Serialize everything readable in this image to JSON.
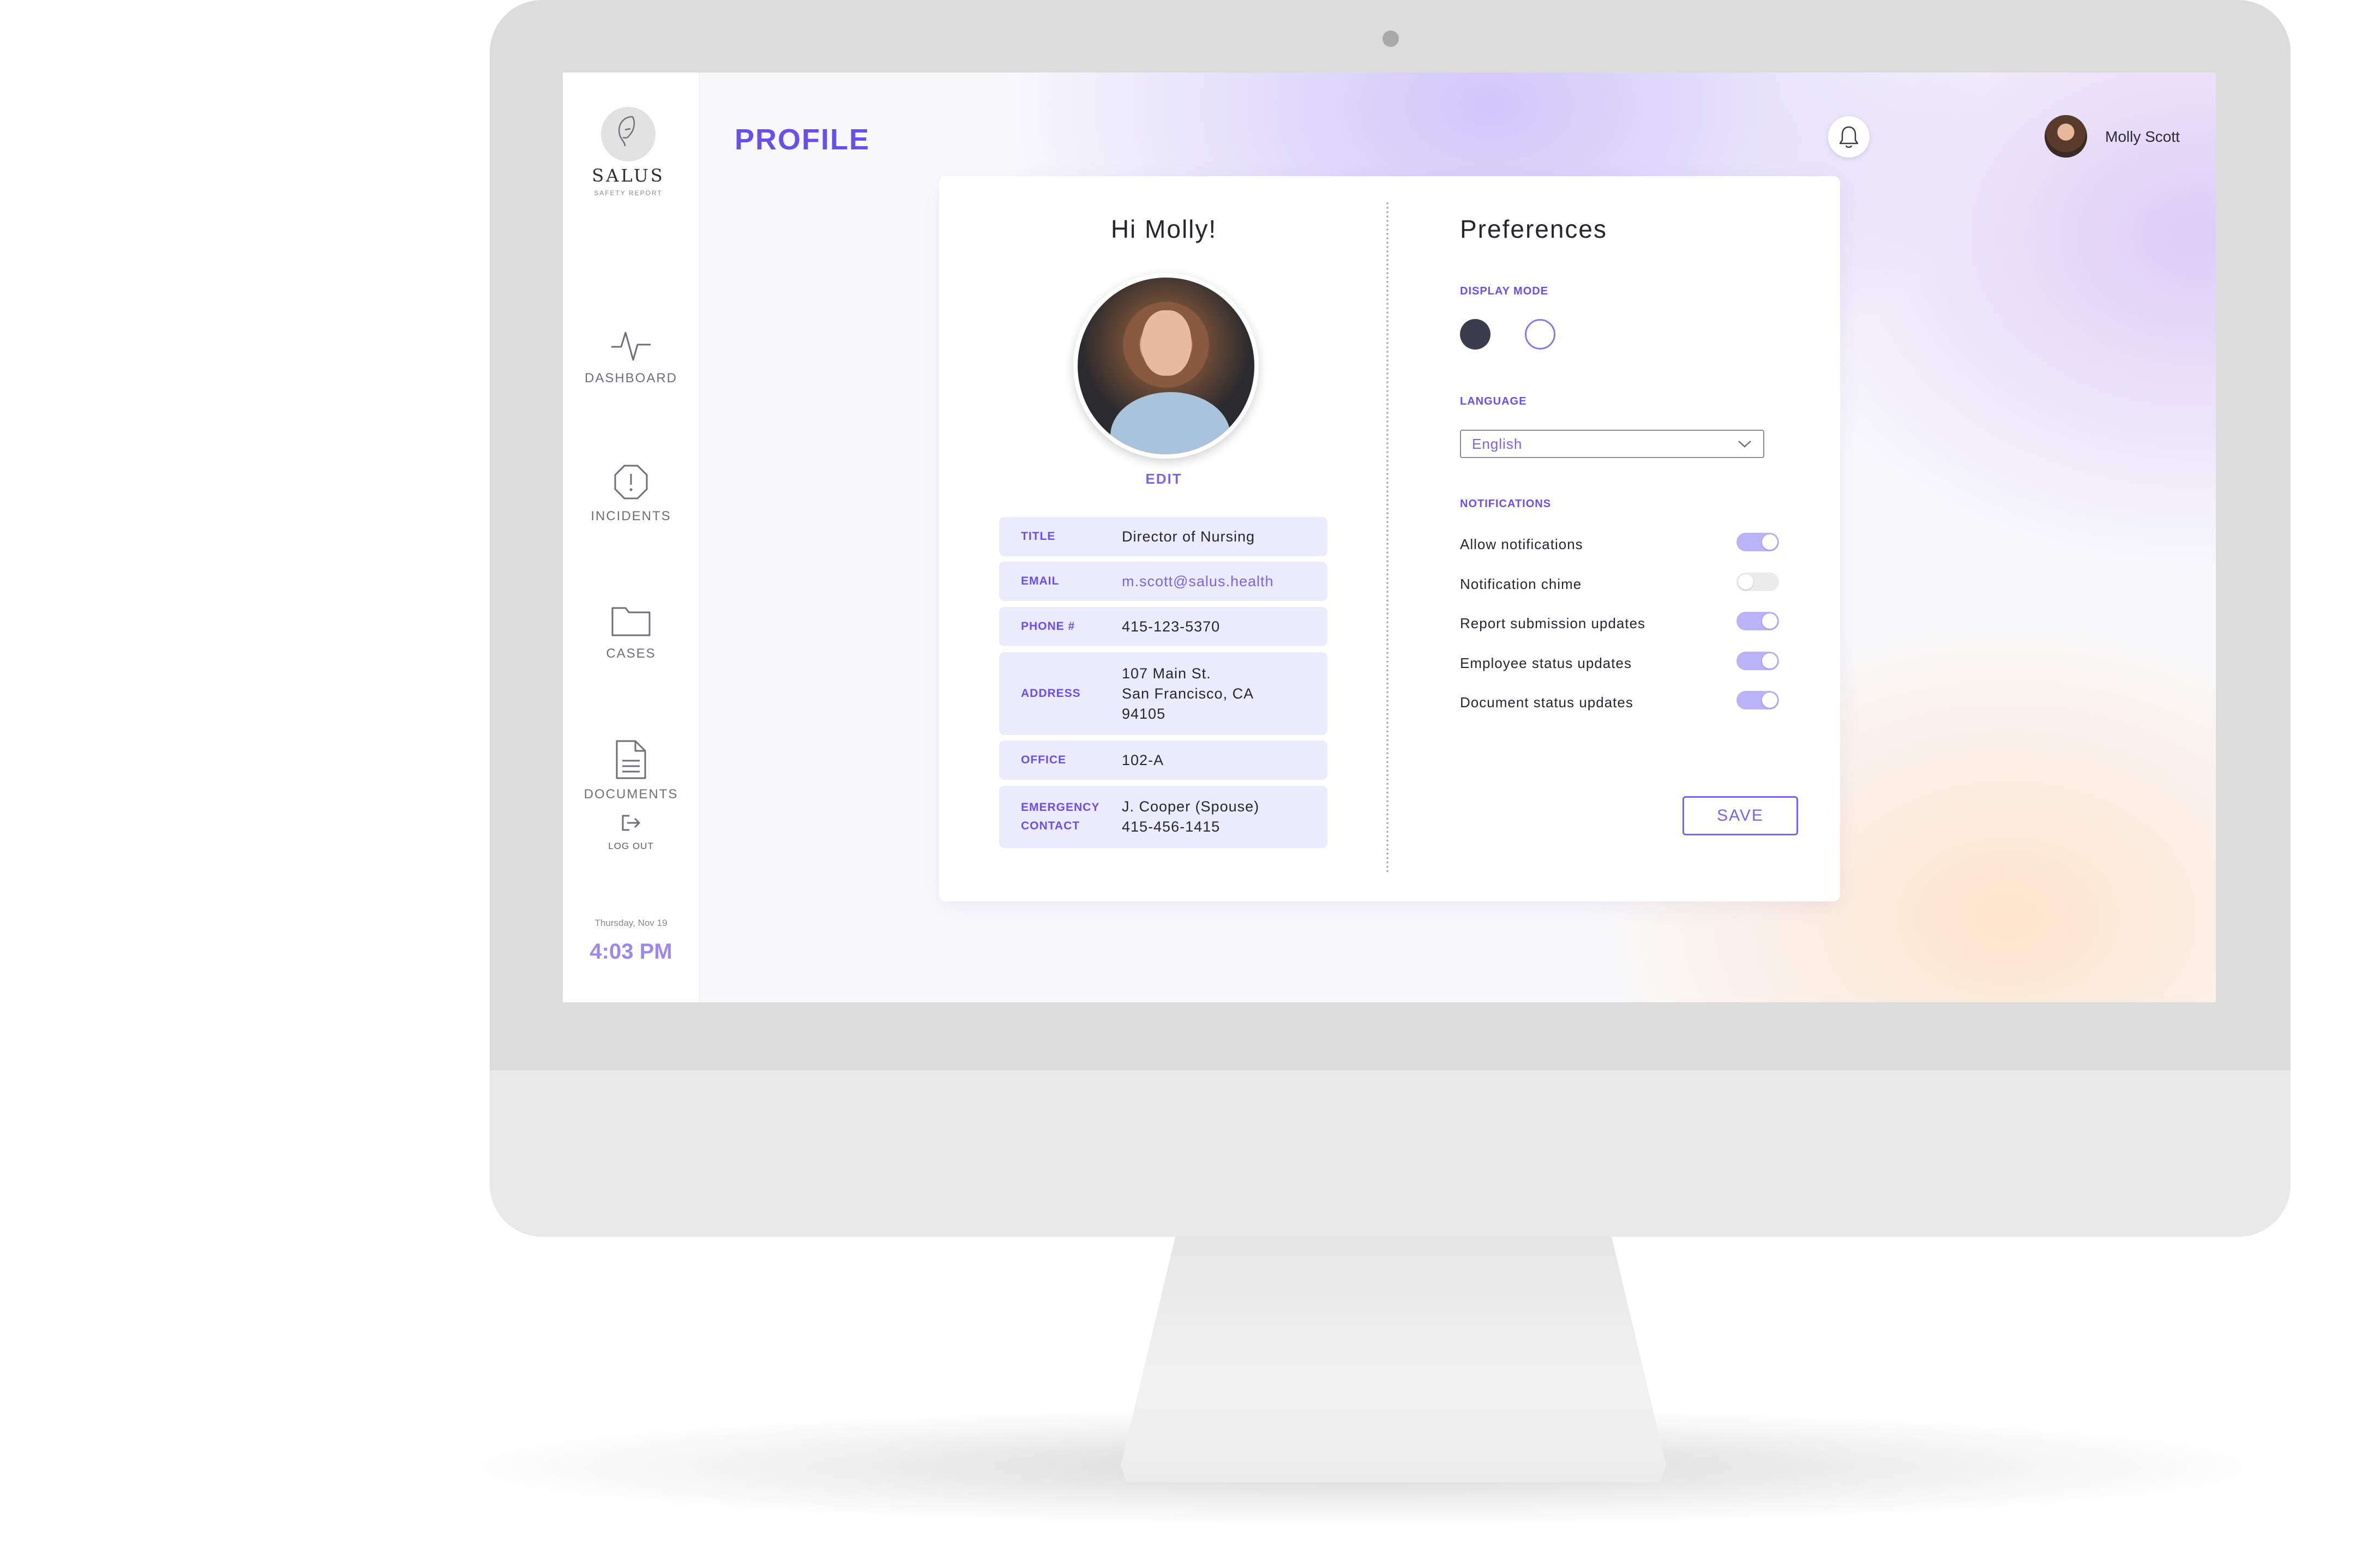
{
  "app": {
    "name": "SALUS",
    "tagline": "SAFETY REPORT"
  },
  "sidebar": {
    "items": [
      {
        "label": "DASHBOARD",
        "icon": "pulse-icon"
      },
      {
        "label": "INCIDENTS",
        "icon": "alert-octagon-icon"
      },
      {
        "label": "CASES",
        "icon": "folder-icon"
      },
      {
        "label": "DOCUMENTS",
        "icon": "document-icon"
      }
    ],
    "logout": {
      "label": "LOG OUT",
      "icon": "logout-icon"
    },
    "date": "Thursday, Nov 19",
    "time": "4:03 PM"
  },
  "header": {
    "title": "PROFILE",
    "bell_icon": "bell-icon",
    "user_name": "Molly Scott"
  },
  "profile": {
    "greeting": "Hi Molly!",
    "edit_label": "EDIT",
    "fields": {
      "title": {
        "label": "TITLE",
        "value": "Director of Nursing"
      },
      "email": {
        "label": "EMAIL",
        "value": "m.scott@salus.health"
      },
      "phone": {
        "label": "PHONE #",
        "value": "415-123-5370"
      },
      "address": {
        "label": "ADDRESS",
        "line1": "107 Main St.",
        "line2": "San Francisco, CA",
        "line3": "94105"
      },
      "office": {
        "label": "OFFICE",
        "value": "102-A"
      },
      "emergency": {
        "label_line1": "EMERGENCY",
        "label_line2": "CONTACT",
        "line1": "J. Cooper (Spouse)",
        "line2": "415-456-1415"
      }
    }
  },
  "preferences": {
    "title": "Preferences",
    "display_mode_label": "DISPLAY MODE",
    "display_mode_selected": "light",
    "language_label": "LANGUAGE",
    "language_value": "English",
    "notifications_label": "NOTIFICATIONS",
    "notifications": [
      {
        "label": "Allow notifications",
        "on": true
      },
      {
        "label": "Notification chime",
        "on": false
      },
      {
        "label": "Report submission updates",
        "on": true
      },
      {
        "label": "Employee status updates",
        "on": true
      },
      {
        "label": "Document status updates",
        "on": true
      }
    ],
    "save_label": "SAVE"
  },
  "colors": {
    "accent": "#6a4ff0",
    "accent_light": "#eceafd",
    "toggle_on": "#bcb2f7",
    "dark_mode_swatch": "#3d3c4f"
  }
}
